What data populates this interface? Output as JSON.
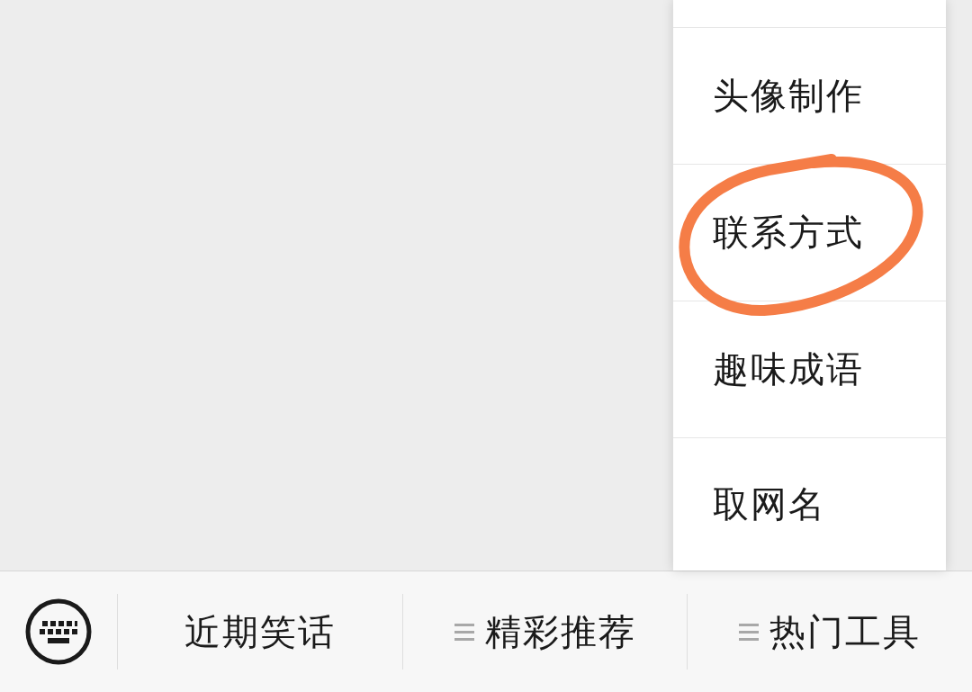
{
  "menu": {
    "items": [
      {
        "label": "头像制作",
        "circled": false
      },
      {
        "label": "联系方式",
        "circled": true
      },
      {
        "label": "趣味成语",
        "circled": false
      },
      {
        "label": "取网名",
        "circled": false
      }
    ]
  },
  "bottom_bar": {
    "tabs": [
      {
        "label": "近期笑话",
        "has_submenu": false
      },
      {
        "label": "精彩推荐",
        "has_submenu": true
      },
      {
        "label": "热门工具",
        "has_submenu": true
      }
    ]
  }
}
